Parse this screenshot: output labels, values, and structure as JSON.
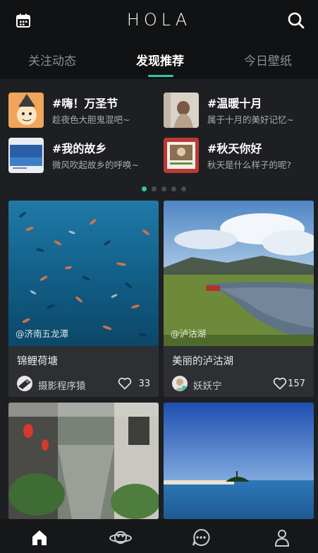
{
  "app": {
    "title": "HOLA"
  },
  "tabs": [
    {
      "label": "关注动态",
      "active": false
    },
    {
      "label": "发现推荐",
      "active": true
    },
    {
      "label": "今日壁纸",
      "active": false
    }
  ],
  "topics": [
    {
      "title": "#嗨！万圣节",
      "subtitle": "趁夜色大胆鬼混吧~"
    },
    {
      "title": "#温暖十月",
      "subtitle": "属于十月的美好记忆~"
    },
    {
      "title": "#我的故乡",
      "subtitle": "微风吹起故乡的呼唤~"
    },
    {
      "title": "#秋天你好",
      "subtitle": "秋天是什么样子的呢?"
    }
  ],
  "carousel": {
    "page_count": 5,
    "active_index": 0
  },
  "cards": [
    {
      "location": "@济南五龙潭",
      "title": "锦鲤荷塘",
      "author": "摄影程序猿",
      "likes": "33"
    },
    {
      "location": "@泸沽湖",
      "title": "美丽的泸沽湖",
      "author": "妖妖宁",
      "likes": "157"
    }
  ],
  "icons": {
    "calendar": "calendar-icon",
    "search": "search-icon",
    "nav": [
      "home-icon",
      "planet-icon",
      "chat-icon",
      "profile-icon"
    ]
  },
  "colors": {
    "accent": "#2fc6b4",
    "background": "#1e1f22",
    "header": "#111213"
  }
}
